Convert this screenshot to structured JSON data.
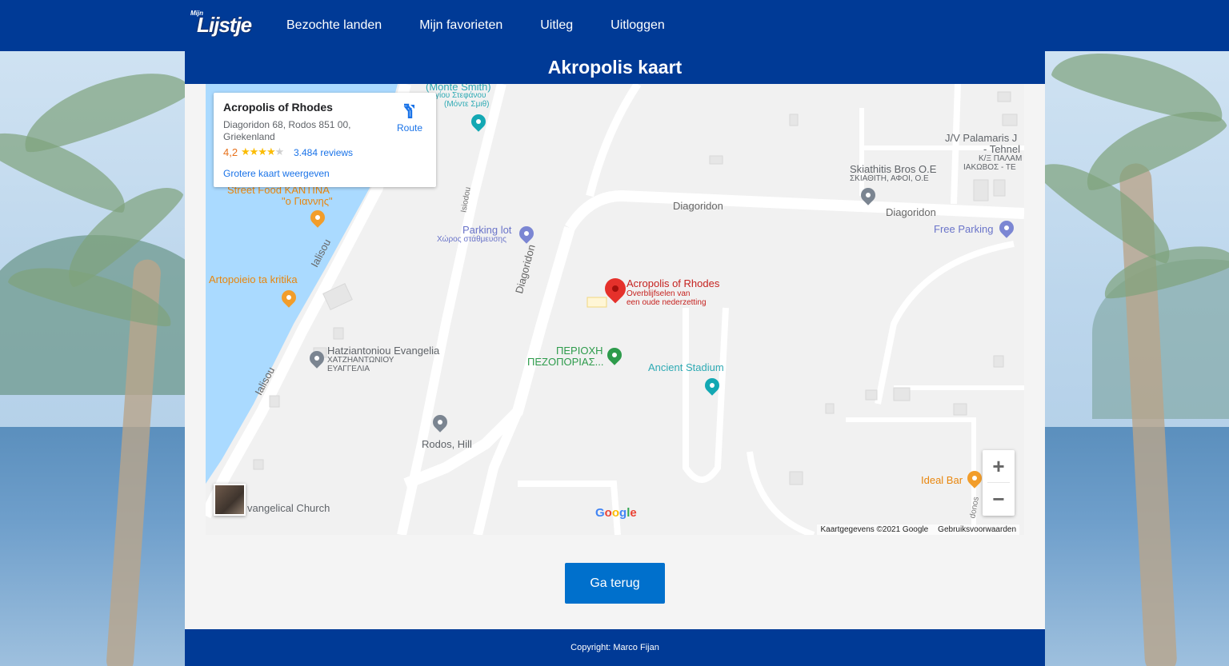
{
  "logo": {
    "small_text": "Mijn",
    "big_text": "Lijstje"
  },
  "nav": {
    "items": [
      {
        "label": "Bezochte landen"
      },
      {
        "label": "Mijn favorieten"
      },
      {
        "label": "Uitleg"
      },
      {
        "label": "Uitloggen"
      }
    ]
  },
  "page": {
    "title": "Akropolis kaart"
  },
  "map": {
    "info_card": {
      "name": "Acropolis of Rhodes",
      "address": "Diagoridon 68, Rodos 851 00, Griekenland",
      "rating": "4,2",
      "stars": 4.2,
      "reviews": "3.484 reviews",
      "bigger_map": "Grotere kaart weergeven",
      "route": "Route",
      "route_icon": "directions-icon"
    },
    "labels": {
      "monte_smith": "(Monte Smith)",
      "monte_smith_gr1": "γίου Στεφάνου",
      "monte_smith_gr2": "(Μόντε Σμιθ)",
      "street_food": "Street Food ΚΑΝΤΙΝΑ",
      "street_food_gr": "\"ο Γιαννης\"",
      "artopoieio": "Artopoieio ta kritika",
      "parking_lot": "Parking lot",
      "parking_lot_gr": "Χώρος στάθμευσης",
      "isiodou": "Isiodou",
      "ialisou1": "Ialisou",
      "ialisou2": "Ialisou",
      "diagoridon_v": "Diagoridon",
      "diagoridon_1": "Diagoridon",
      "diagoridon_2": "Diagoridon",
      "hatz": "Hatziantoniou Evangelia",
      "hatz_gr1": "ΧΑΤΖΗΑΝΤΩΝΙΟΥ",
      "hatz_gr2": "ΕΥΑΓΓΕΛΙΑ",
      "periochi1": "ΠΕΡΙΟΧΗ",
      "periochi2": "ΠΕΖΟΠΟΡΙΑΣ...",
      "ancient_stadium": "Ancient Stadium",
      "acropolis": "Acropolis of Rhodes",
      "acropolis_sub1": "Overblijfselen van",
      "acropolis_sub2": "een oude nederzetting",
      "skiathitis": "Skiathitis Bros O.E",
      "skiathitis_gr": "ΣΚΙΑΘΙΤΗ, ΑΦΟΙ, Ο.Ε",
      "palamaris1": "J/V Palamaris J",
      "palamaris2": "- Tehnel",
      "palamaris3": "Κ/Ξ ΠΑΛΑΜ",
      "palamaris4": "ΙΑΚΩΒΟΣ - ΤΕ",
      "free_parking": "Free Parking",
      "rodos_hill": "Rodos, Hill",
      "evangelical": "vangelical Church",
      "ideal_bar": "Ideal Bar",
      "donos": "donos"
    },
    "zoom_in": "+",
    "zoom_out": "−",
    "google": "Google",
    "attribution": "Kaartgegevens ©2021 Google",
    "terms": "Gebruiksvoorwaarden"
  },
  "actions": {
    "back": "Ga terug"
  },
  "footer": {
    "copyright": "Copyright: Marco Fijan"
  },
  "colors": {
    "brand": "#003a96",
    "button": "#0070cc",
    "marker": "#e5312b"
  }
}
